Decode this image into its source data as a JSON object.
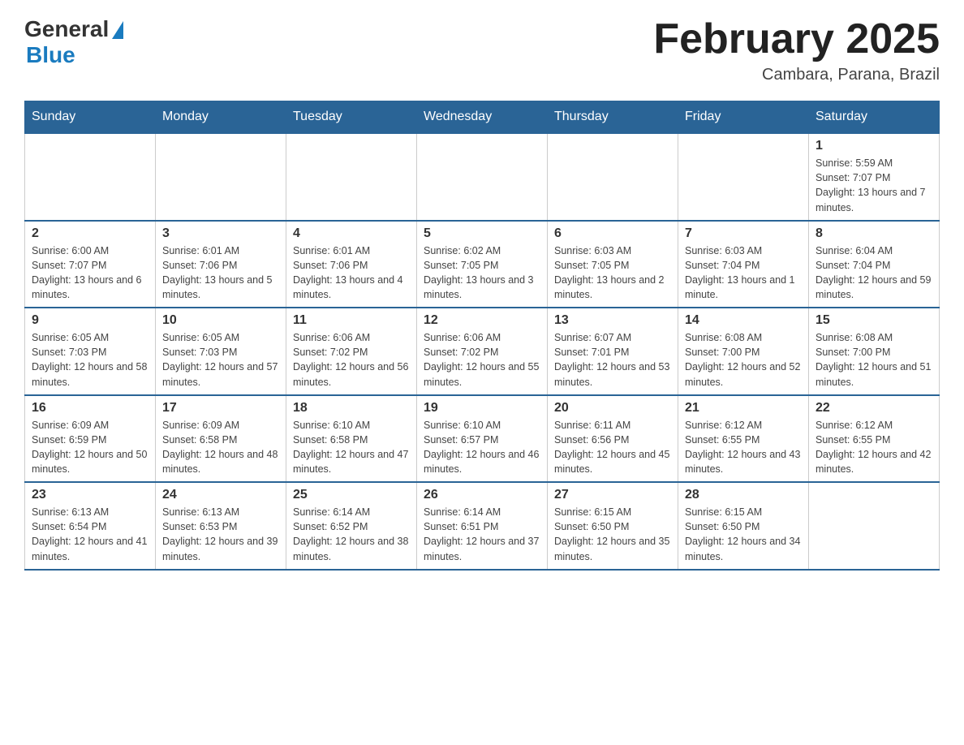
{
  "header": {
    "logo_general": "General",
    "logo_blue": "Blue",
    "title": "February 2025",
    "location": "Cambara, Parana, Brazil"
  },
  "days_of_week": [
    "Sunday",
    "Monday",
    "Tuesday",
    "Wednesday",
    "Thursday",
    "Friday",
    "Saturday"
  ],
  "weeks": [
    [
      {
        "day": "",
        "info": ""
      },
      {
        "day": "",
        "info": ""
      },
      {
        "day": "",
        "info": ""
      },
      {
        "day": "",
        "info": ""
      },
      {
        "day": "",
        "info": ""
      },
      {
        "day": "",
        "info": ""
      },
      {
        "day": "1",
        "info": "Sunrise: 5:59 AM\nSunset: 7:07 PM\nDaylight: 13 hours and 7 minutes."
      }
    ],
    [
      {
        "day": "2",
        "info": "Sunrise: 6:00 AM\nSunset: 7:07 PM\nDaylight: 13 hours and 6 minutes."
      },
      {
        "day": "3",
        "info": "Sunrise: 6:01 AM\nSunset: 7:06 PM\nDaylight: 13 hours and 5 minutes."
      },
      {
        "day": "4",
        "info": "Sunrise: 6:01 AM\nSunset: 7:06 PM\nDaylight: 13 hours and 4 minutes."
      },
      {
        "day": "5",
        "info": "Sunrise: 6:02 AM\nSunset: 7:05 PM\nDaylight: 13 hours and 3 minutes."
      },
      {
        "day": "6",
        "info": "Sunrise: 6:03 AM\nSunset: 7:05 PM\nDaylight: 13 hours and 2 minutes."
      },
      {
        "day": "7",
        "info": "Sunrise: 6:03 AM\nSunset: 7:04 PM\nDaylight: 13 hours and 1 minute."
      },
      {
        "day": "8",
        "info": "Sunrise: 6:04 AM\nSunset: 7:04 PM\nDaylight: 12 hours and 59 minutes."
      }
    ],
    [
      {
        "day": "9",
        "info": "Sunrise: 6:05 AM\nSunset: 7:03 PM\nDaylight: 12 hours and 58 minutes."
      },
      {
        "day": "10",
        "info": "Sunrise: 6:05 AM\nSunset: 7:03 PM\nDaylight: 12 hours and 57 minutes."
      },
      {
        "day": "11",
        "info": "Sunrise: 6:06 AM\nSunset: 7:02 PM\nDaylight: 12 hours and 56 minutes."
      },
      {
        "day": "12",
        "info": "Sunrise: 6:06 AM\nSunset: 7:02 PM\nDaylight: 12 hours and 55 minutes."
      },
      {
        "day": "13",
        "info": "Sunrise: 6:07 AM\nSunset: 7:01 PM\nDaylight: 12 hours and 53 minutes."
      },
      {
        "day": "14",
        "info": "Sunrise: 6:08 AM\nSunset: 7:00 PM\nDaylight: 12 hours and 52 minutes."
      },
      {
        "day": "15",
        "info": "Sunrise: 6:08 AM\nSunset: 7:00 PM\nDaylight: 12 hours and 51 minutes."
      }
    ],
    [
      {
        "day": "16",
        "info": "Sunrise: 6:09 AM\nSunset: 6:59 PM\nDaylight: 12 hours and 50 minutes."
      },
      {
        "day": "17",
        "info": "Sunrise: 6:09 AM\nSunset: 6:58 PM\nDaylight: 12 hours and 48 minutes."
      },
      {
        "day": "18",
        "info": "Sunrise: 6:10 AM\nSunset: 6:58 PM\nDaylight: 12 hours and 47 minutes."
      },
      {
        "day": "19",
        "info": "Sunrise: 6:10 AM\nSunset: 6:57 PM\nDaylight: 12 hours and 46 minutes."
      },
      {
        "day": "20",
        "info": "Sunrise: 6:11 AM\nSunset: 6:56 PM\nDaylight: 12 hours and 45 minutes."
      },
      {
        "day": "21",
        "info": "Sunrise: 6:12 AM\nSunset: 6:55 PM\nDaylight: 12 hours and 43 minutes."
      },
      {
        "day": "22",
        "info": "Sunrise: 6:12 AM\nSunset: 6:55 PM\nDaylight: 12 hours and 42 minutes."
      }
    ],
    [
      {
        "day": "23",
        "info": "Sunrise: 6:13 AM\nSunset: 6:54 PM\nDaylight: 12 hours and 41 minutes."
      },
      {
        "day": "24",
        "info": "Sunrise: 6:13 AM\nSunset: 6:53 PM\nDaylight: 12 hours and 39 minutes."
      },
      {
        "day": "25",
        "info": "Sunrise: 6:14 AM\nSunset: 6:52 PM\nDaylight: 12 hours and 38 minutes."
      },
      {
        "day": "26",
        "info": "Sunrise: 6:14 AM\nSunset: 6:51 PM\nDaylight: 12 hours and 37 minutes."
      },
      {
        "day": "27",
        "info": "Sunrise: 6:15 AM\nSunset: 6:50 PM\nDaylight: 12 hours and 35 minutes."
      },
      {
        "day": "28",
        "info": "Sunrise: 6:15 AM\nSunset: 6:50 PM\nDaylight: 12 hours and 34 minutes."
      },
      {
        "day": "",
        "info": ""
      }
    ]
  ]
}
